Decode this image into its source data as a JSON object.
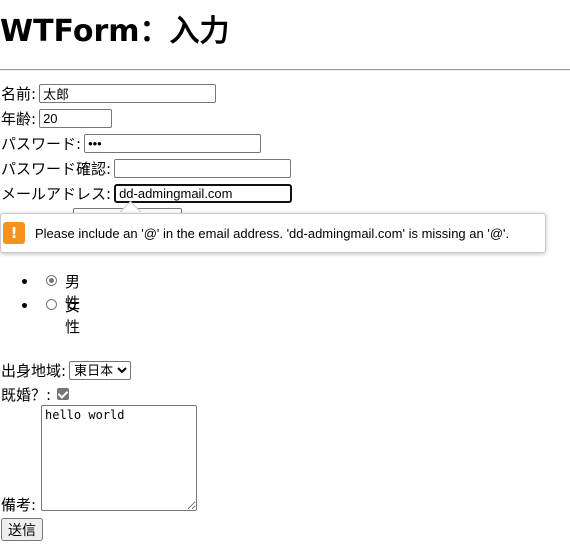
{
  "page": {
    "title": "WTForm：入力"
  },
  "form": {
    "name": {
      "label": "名前:",
      "value": "太郎"
    },
    "age": {
      "label": "年齢:",
      "value": "20"
    },
    "password": {
      "label": "パスワード:",
      "value": "•••"
    },
    "password_confirm": {
      "label": "パスワード確認:",
      "value": ""
    },
    "email": {
      "label": "メールアドレス:",
      "value": "dd-admingmail.com"
    },
    "gender": {
      "options": [
        {
          "label": "男性",
          "checked": true
        },
        {
          "label": "女性",
          "checked": false
        }
      ]
    },
    "region": {
      "label": "出身地域:",
      "selected": "東日本"
    },
    "married": {
      "label": "既婚？:",
      "checked": true
    },
    "memo": {
      "label": "備考:",
      "value": "hello world"
    },
    "submit_label": "送信"
  },
  "validation_tooltip": {
    "icon": "warning-icon",
    "icon_glyph": "!",
    "message": "Please include an '@' in the email address. 'dd-admingmail.com' is missing an '@'."
  },
  "colors": {
    "warning": "#f5921e"
  }
}
